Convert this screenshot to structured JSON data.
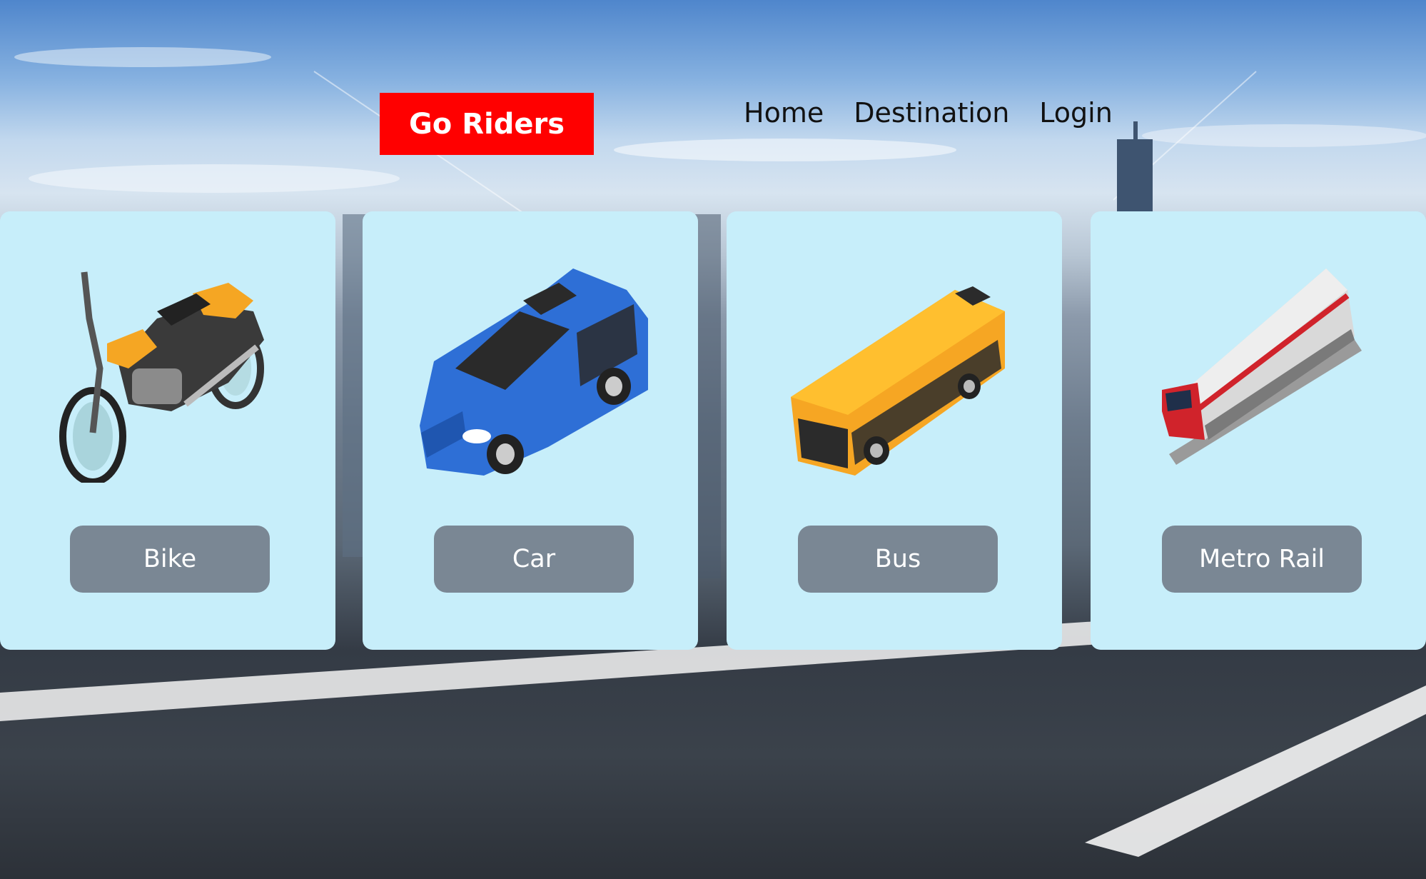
{
  "brand": {
    "name": "Go Riders"
  },
  "nav": {
    "items": [
      {
        "label": "Home"
      },
      {
        "label": "Destination"
      },
      {
        "label": "Login"
      }
    ]
  },
  "vehicles": [
    {
      "label": "Bike",
      "icon": "motorbike-icon"
    },
    {
      "label": "Car",
      "icon": "car-icon"
    },
    {
      "label": "Bus",
      "icon": "bus-icon"
    },
    {
      "label": "Metro Rail",
      "icon": "train-icon"
    }
  ],
  "colors": {
    "brand": "#ff0000",
    "card": "#c7eefa",
    "button": "#7a8794"
  }
}
